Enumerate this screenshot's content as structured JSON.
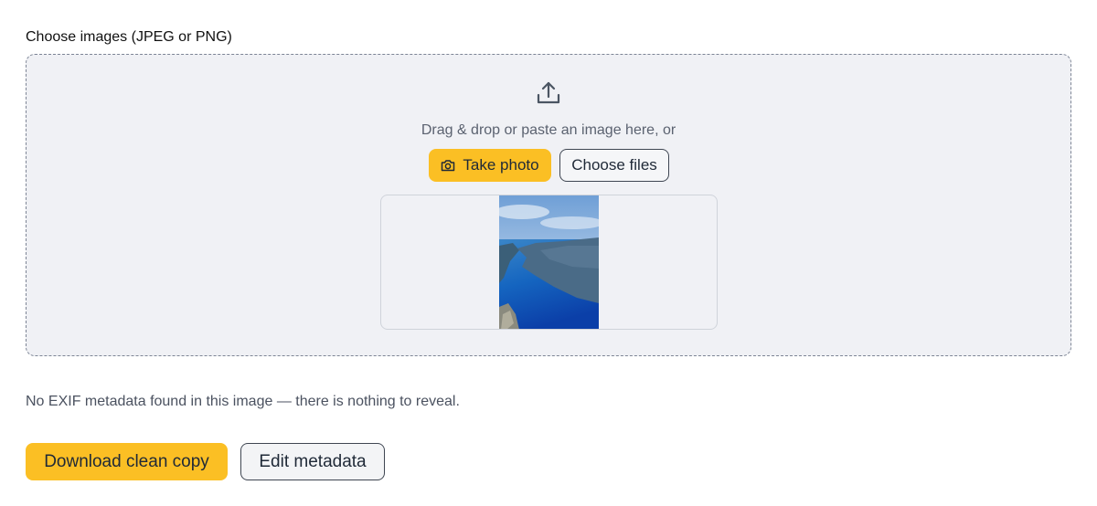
{
  "upload": {
    "label": "Choose images (JPEG or PNG)",
    "upload_icon": "upload-tray-icon",
    "hint": "Drag & drop or paste an image here, or",
    "take_photo_icon": "camera-icon",
    "take_photo_label": "Take photo",
    "choose_files_label": "Choose files"
  },
  "preview": {
    "image_description_icon": "photo-thumbnail"
  },
  "result": {
    "status": "No EXIF metadata found in this image — there is nothing to reveal."
  },
  "actions": {
    "download_label": "Download clean copy",
    "edit_label": "Edit metadata"
  },
  "colors": {
    "accent": "#fbbf24",
    "dropzone_bg": "#f0f1f5",
    "border": "#3f4652"
  }
}
